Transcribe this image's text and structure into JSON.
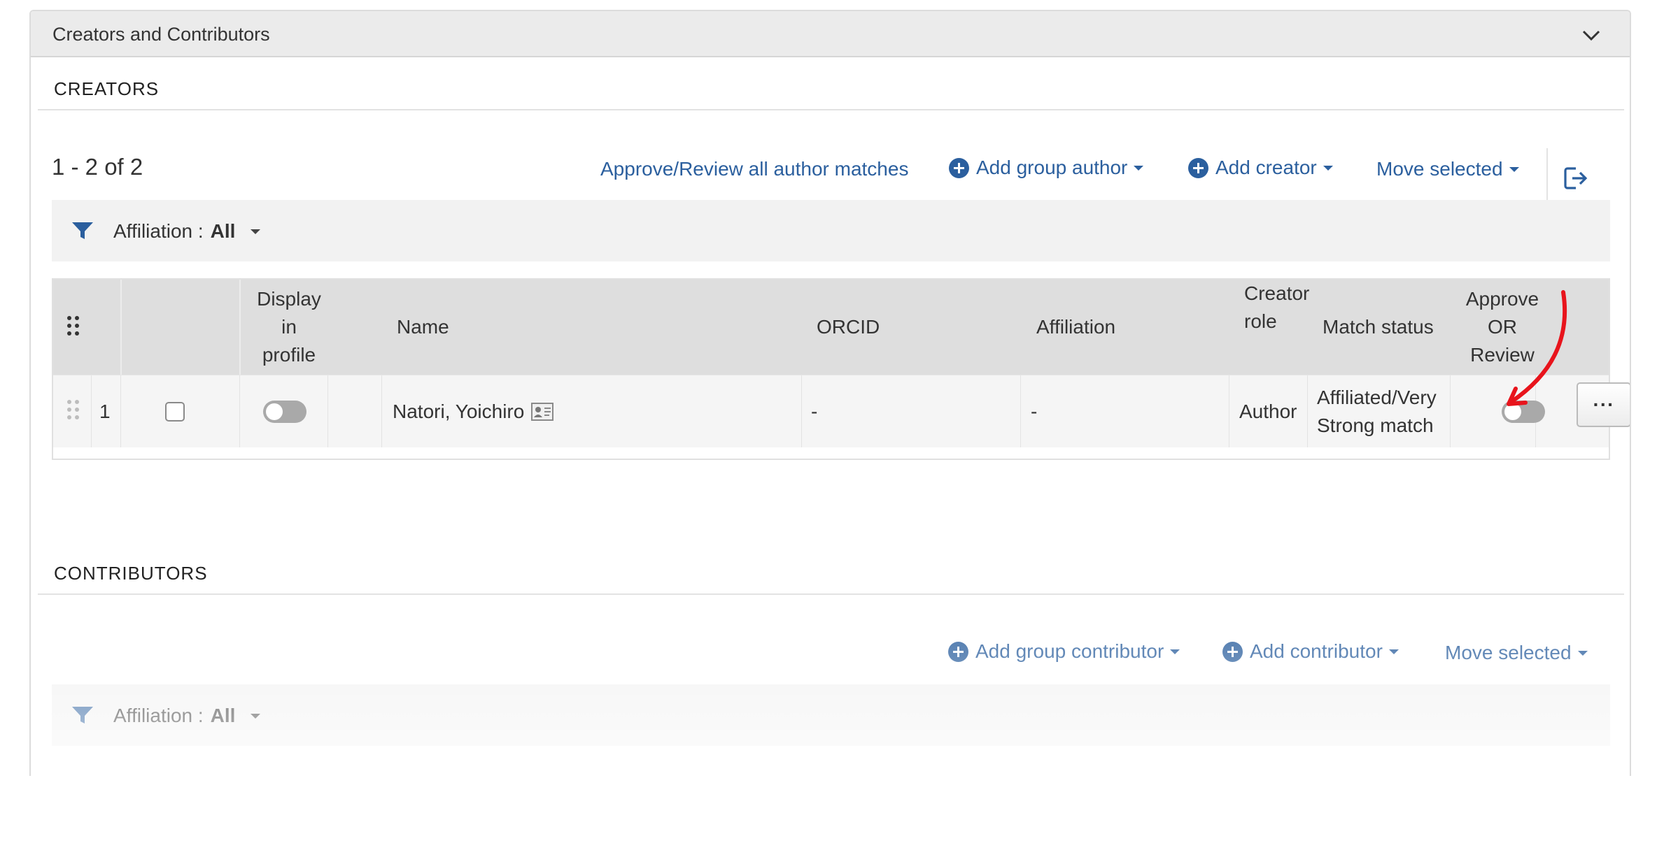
{
  "panel": {
    "title": "Creators and Contributors",
    "collapse_icon": "chevron-down-icon"
  },
  "creators": {
    "section_title": "CREATORS",
    "count_text": "1 - 2 of 2",
    "toolbar": {
      "approve_all_label": "Approve/Review all author matches",
      "add_group_author_label": "Add group author",
      "add_creator_label": "Add creator",
      "move_selected_label": "Move selected",
      "export_icon": "export-icon"
    },
    "filter": {
      "label": "Affiliation :",
      "value": "All"
    },
    "table": {
      "columns": {
        "display_in_profile": [
          "Display",
          "in",
          "profile"
        ],
        "name": "Name",
        "orcid": "ORCID",
        "affiliation": "Affiliation",
        "creator_role": [
          "Creator",
          "role"
        ],
        "match_status": "Match status",
        "approve_or_review": [
          "Approve",
          "OR",
          "Review"
        ]
      },
      "rows": [
        {
          "index": "1",
          "selected": false,
          "display_in_profile": false,
          "name": "Natori, Yoichiro",
          "orcid": "-",
          "affiliation": "-",
          "creator_role": "Author",
          "match_status": [
            "Affiliated/Very",
            "Strong match"
          ],
          "approve_or_review": false,
          "actions_label": "···"
        }
      ]
    }
  },
  "contributors": {
    "section_title": "CONTRIBUTORS",
    "toolbar": {
      "add_group_contributor_label": "Add group contributor",
      "add_contributor_label": "Add contributor",
      "move_selected_label": "Move selected"
    },
    "filter": {
      "label": "Affiliation :",
      "value": "All"
    }
  },
  "colors": {
    "link": "#2b5f9e",
    "header_bg": "#ebebeb",
    "table_header_bg": "#dedede",
    "annotation": "#e8141c"
  }
}
